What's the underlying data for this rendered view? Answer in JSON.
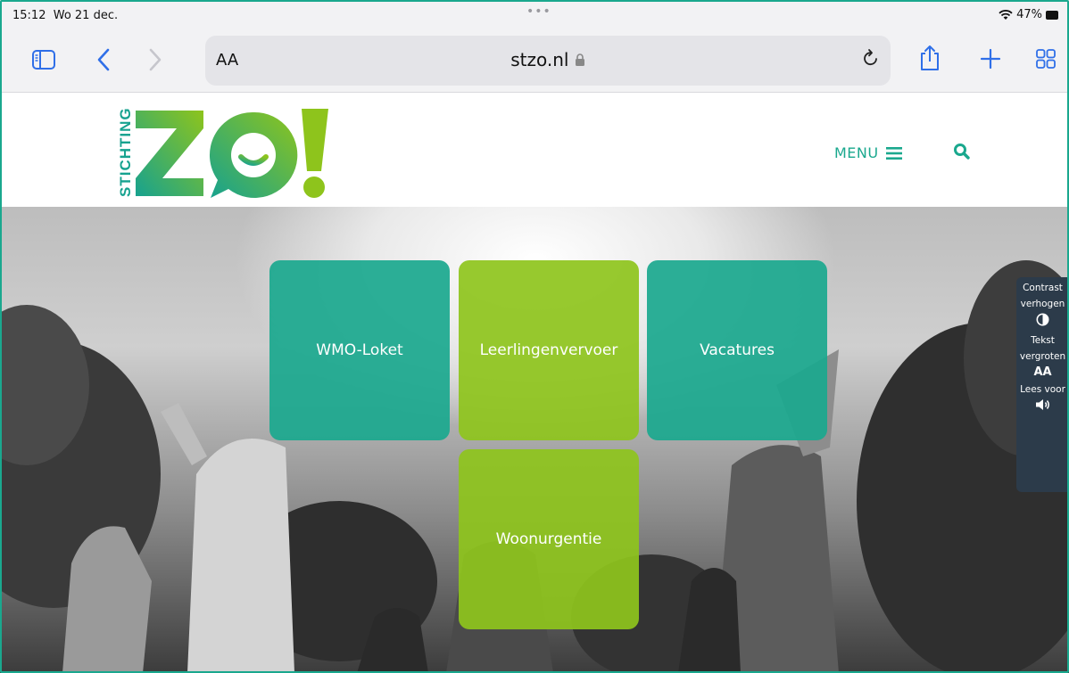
{
  "status_bar": {
    "time": "15:12",
    "date": "Wo 21 dec.",
    "dots": "•••",
    "battery": "47%"
  },
  "toolbar": {
    "text_size_label": "AA",
    "url": "stzo.nl"
  },
  "site": {
    "logo_text": "STICHTING",
    "menu_label": "MENU"
  },
  "tiles": [
    {
      "label": "WMO-Loket",
      "color": "#1aa88e"
    },
    {
      "label": "Leerlingenvervoer",
      "color": "#8ec41c"
    },
    {
      "label": "Vacatures",
      "color": "#1aa88e"
    },
    {
      "label": "Woonurgentie",
      "color": "#8ec41c"
    }
  ],
  "accessibility": {
    "contrast_1": "Contrast",
    "contrast_2": "verhogen",
    "text_1": "Tekst",
    "text_2": "vergroten",
    "text_icon": "AA",
    "read": "Lees voor"
  },
  "colors": {
    "brand_teal": "#1aa88e",
    "brand_lime": "#8ec41c",
    "safari_blue": "#2f6fe8",
    "panel": "#2c3b4a"
  }
}
